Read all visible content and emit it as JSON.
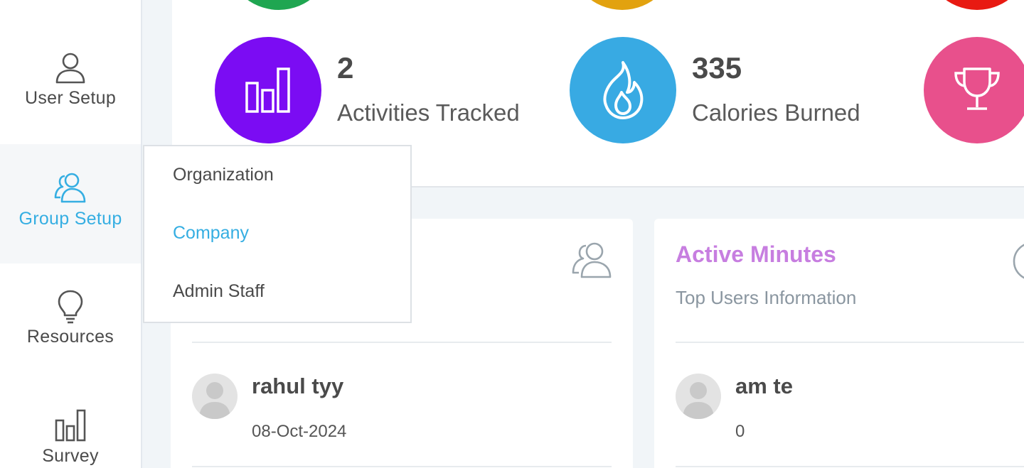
{
  "sidebar": {
    "items": [
      {
        "label": "User Setup",
        "icon": "user-icon"
      },
      {
        "label": "Group Setup",
        "icon": "users-icon",
        "active": true
      },
      {
        "label": "Resources",
        "icon": "lightbulb-icon"
      },
      {
        "label": "Survey",
        "icon": "bar-chart-icon"
      }
    ]
  },
  "stats": [
    {
      "value": "2",
      "label": "Activities Tracked",
      "color": "#7b0cf3",
      "icon": "bar-chart-icon"
    },
    {
      "value": "335",
      "label": "Calories Burned",
      "color": "#38aae3",
      "icon": "fire-icon"
    },
    {
      "color": "#e8508c",
      "icon": "trophy-icon"
    }
  ],
  "top_partial_circle_colors": [
    "#1fa651",
    "#e2a20f",
    "#e81a12"
  ],
  "dropdown": {
    "items": [
      {
        "label": "Organization"
      },
      {
        "label": "Company",
        "active": true
      },
      {
        "label": "Admin Staff"
      }
    ]
  },
  "cards": [
    {
      "icon": "users-icon",
      "user": {
        "name": "rahul tyy",
        "meta": "08-Oct-2024"
      }
    },
    {
      "title": "Active Minutes",
      "subtitle": "Top Users Information",
      "icon": "clock-icon",
      "user": {
        "name": "am te",
        "meta": "0"
      }
    }
  ]
}
